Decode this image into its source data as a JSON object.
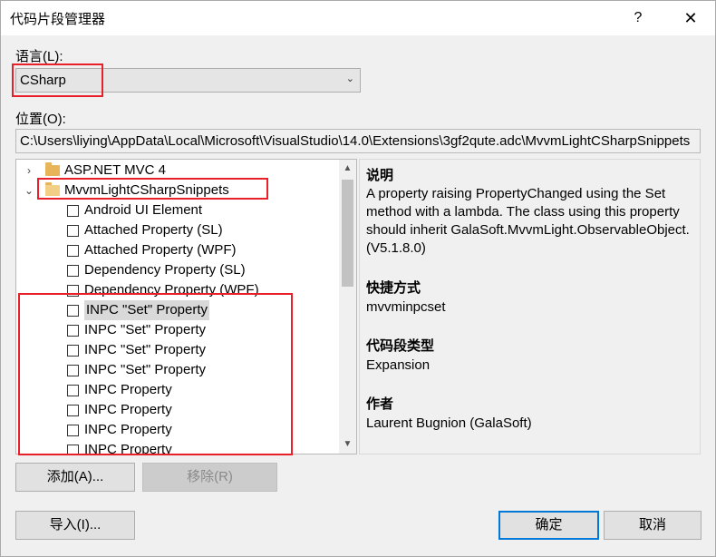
{
  "window": {
    "title": "代码片段管理器",
    "help_glyph": "?",
    "close_glyph": "✕"
  },
  "language": {
    "label": "语言(L):",
    "selected": "CSharp"
  },
  "location": {
    "label": "位置(O):",
    "path": "C:\\Users\\liying\\AppData\\Local\\Microsoft\\VisualStudio\\14.0\\Extensions\\3gf2qute.adc\\MvvmLightCSharpSnippets"
  },
  "tree": {
    "folders": [
      {
        "label": "ASP.NET MVC 4",
        "expanded": false
      },
      {
        "label": "MvvmLightCSharpSnippets",
        "expanded": true
      }
    ],
    "snippets": [
      "Android UI Element",
      "Attached Property (SL)",
      "Attached Property (WPF)",
      "Dependency Property (SL)",
      "Dependency Property (WPF)",
      "INPC \"Set\" Property",
      "INPC \"Set\" Property",
      "INPC \"Set\" Property",
      "INPC \"Set\" Property",
      "INPC Property",
      "INPC Property",
      "INPC Property",
      "INPC Property"
    ],
    "selected_snippet_index": 5
  },
  "details": {
    "description_heading": "说明",
    "description": "A property raising PropertyChanged using the Set method with a lambda. The class using this property should inherit GalaSoft.MvvmLight.ObservableObject. (V5.1.8.0)",
    "shortcut_heading": "快捷方式",
    "shortcut": "mvvminpcset",
    "type_heading": "代码段类型",
    "type": "Expansion",
    "author_heading": "作者",
    "author": "Laurent Bugnion (GalaSoft)"
  },
  "buttons": {
    "add": "添加(A)...",
    "remove": "移除(R)",
    "import": "导入(I)...",
    "ok": "确定",
    "cancel": "取消"
  },
  "colors": {
    "highlight": "#e8202a",
    "accent": "#0078d7"
  }
}
